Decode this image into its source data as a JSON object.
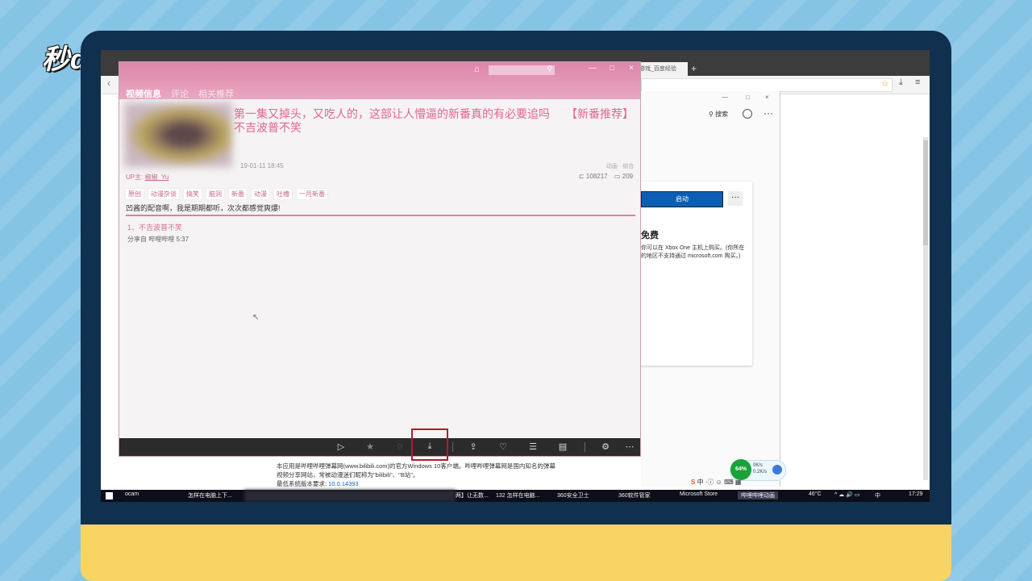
{
  "watermark": {
    "brand": "秒dong视频"
  },
  "browser": {
    "tab_title": "游戏_百度经验",
    "new_tab": "+"
  },
  "store": {
    "controls": [
      "—",
      "□",
      "×"
    ],
    "search_label": "⚲ 搜索",
    "more": "···",
    "launch_label": "启动",
    "card_more": "···",
    "free_label": "免费",
    "free_desc": "你可以在 Xbox One 主机上购买。(你所在的地区不支持通过 microsoft.com 购买。)"
  },
  "description": {
    "line1": "本应用是哔哩哔哩弹幕网(www.bilibili.com)的官方Windows 10客户端。哔哩哔哩弹幕网是国内知名的弹幕",
    "line2": "视频分享网站，常被动漫迷们昵称为\"bilibili\"、\"B站\"。",
    "line3_prefix": "最低系统版本要求:",
    "version": "10.0.14393"
  },
  "bili": {
    "window_controls": [
      "—",
      "□",
      "×"
    ],
    "tabs": [
      {
        "label": "视频信息",
        "active": true
      },
      {
        "label": "评论",
        "active": false
      },
      {
        "label": "相关推荐",
        "active": false
      }
    ],
    "video": {
      "title": "第一集又掉头，又吃人的，这部让人懵逼的新番真的有必要追吗",
      "title_tag": "【新番推荐】不吉波普不笑",
      "date": "19-01-11 18:45",
      "category": "动画 · 综合",
      "uploader_label": "UP主:",
      "uploader_name": "椒椒_Yu",
      "play_count": "⊏ 108217",
      "danmaku_count": "▭ 209",
      "tags": [
        "原创",
        "动漫杂谈",
        "搞笑",
        "脑洞",
        "新番",
        "动漫",
        "吐槽",
        "一月新番"
      ],
      "summary": "凹酱的配音啊，我是期期都听，次次都感觉爽爆!",
      "episode": "1、不吉波普不笑",
      "share_from": "分享自 哔哩哔哩 5:37"
    }
  },
  "widgets": {
    "cpu_percent": "64%",
    "net_up": "0K/s",
    "net_down": "0.2K/s",
    "ime": "中"
  },
  "taskbar": {
    "items": [
      "ocam",
      "怎样在电脑上下...",
      "两】让无数...",
      "132 怎样在电脑...",
      "360安全卫士",
      "360软件管家",
      "Microsoft Store",
      "哔哩哔哩动画"
    ],
    "temp": "46°C",
    "cpu_temp": "CPU温度",
    "time": "17:29",
    "date": "2019/1/13",
    "lang": "中"
  }
}
